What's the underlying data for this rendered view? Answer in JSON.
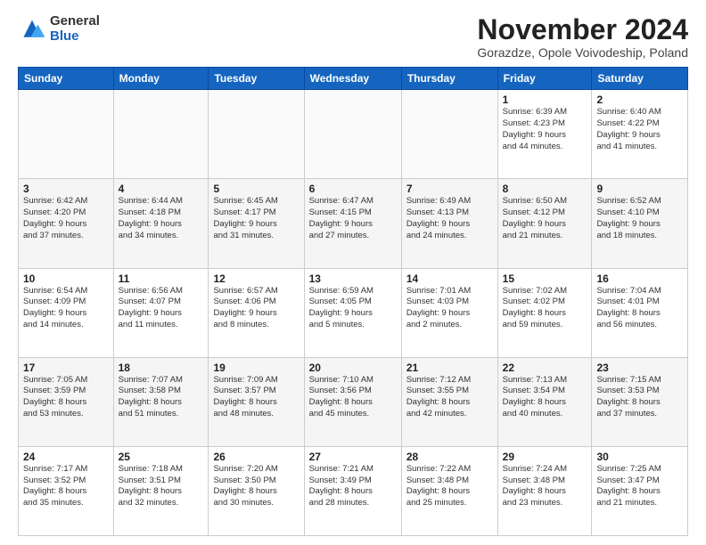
{
  "logo": {
    "general": "General",
    "blue": "Blue"
  },
  "header": {
    "month": "November 2024",
    "location": "Gorazdze, Opole Voivodeship, Poland"
  },
  "days_of_week": [
    "Sunday",
    "Monday",
    "Tuesday",
    "Wednesday",
    "Thursday",
    "Friday",
    "Saturday"
  ],
  "weeks": [
    [
      {
        "day": "",
        "info": ""
      },
      {
        "day": "",
        "info": ""
      },
      {
        "day": "",
        "info": ""
      },
      {
        "day": "",
        "info": ""
      },
      {
        "day": "",
        "info": ""
      },
      {
        "day": "1",
        "info": "Sunrise: 6:39 AM\nSunset: 4:23 PM\nDaylight: 9 hours\nand 44 minutes."
      },
      {
        "day": "2",
        "info": "Sunrise: 6:40 AM\nSunset: 4:22 PM\nDaylight: 9 hours\nand 41 minutes."
      }
    ],
    [
      {
        "day": "3",
        "info": "Sunrise: 6:42 AM\nSunset: 4:20 PM\nDaylight: 9 hours\nand 37 minutes."
      },
      {
        "day": "4",
        "info": "Sunrise: 6:44 AM\nSunset: 4:18 PM\nDaylight: 9 hours\nand 34 minutes."
      },
      {
        "day": "5",
        "info": "Sunrise: 6:45 AM\nSunset: 4:17 PM\nDaylight: 9 hours\nand 31 minutes."
      },
      {
        "day": "6",
        "info": "Sunrise: 6:47 AM\nSunset: 4:15 PM\nDaylight: 9 hours\nand 27 minutes."
      },
      {
        "day": "7",
        "info": "Sunrise: 6:49 AM\nSunset: 4:13 PM\nDaylight: 9 hours\nand 24 minutes."
      },
      {
        "day": "8",
        "info": "Sunrise: 6:50 AM\nSunset: 4:12 PM\nDaylight: 9 hours\nand 21 minutes."
      },
      {
        "day": "9",
        "info": "Sunrise: 6:52 AM\nSunset: 4:10 PM\nDaylight: 9 hours\nand 18 minutes."
      }
    ],
    [
      {
        "day": "10",
        "info": "Sunrise: 6:54 AM\nSunset: 4:09 PM\nDaylight: 9 hours\nand 14 minutes."
      },
      {
        "day": "11",
        "info": "Sunrise: 6:56 AM\nSunset: 4:07 PM\nDaylight: 9 hours\nand 11 minutes."
      },
      {
        "day": "12",
        "info": "Sunrise: 6:57 AM\nSunset: 4:06 PM\nDaylight: 9 hours\nand 8 minutes."
      },
      {
        "day": "13",
        "info": "Sunrise: 6:59 AM\nSunset: 4:05 PM\nDaylight: 9 hours\nand 5 minutes."
      },
      {
        "day": "14",
        "info": "Sunrise: 7:01 AM\nSunset: 4:03 PM\nDaylight: 9 hours\nand 2 minutes."
      },
      {
        "day": "15",
        "info": "Sunrise: 7:02 AM\nSunset: 4:02 PM\nDaylight: 8 hours\nand 59 minutes."
      },
      {
        "day": "16",
        "info": "Sunrise: 7:04 AM\nSunset: 4:01 PM\nDaylight: 8 hours\nand 56 minutes."
      }
    ],
    [
      {
        "day": "17",
        "info": "Sunrise: 7:05 AM\nSunset: 3:59 PM\nDaylight: 8 hours\nand 53 minutes."
      },
      {
        "day": "18",
        "info": "Sunrise: 7:07 AM\nSunset: 3:58 PM\nDaylight: 8 hours\nand 51 minutes."
      },
      {
        "day": "19",
        "info": "Sunrise: 7:09 AM\nSunset: 3:57 PM\nDaylight: 8 hours\nand 48 minutes."
      },
      {
        "day": "20",
        "info": "Sunrise: 7:10 AM\nSunset: 3:56 PM\nDaylight: 8 hours\nand 45 minutes."
      },
      {
        "day": "21",
        "info": "Sunrise: 7:12 AM\nSunset: 3:55 PM\nDaylight: 8 hours\nand 42 minutes."
      },
      {
        "day": "22",
        "info": "Sunrise: 7:13 AM\nSunset: 3:54 PM\nDaylight: 8 hours\nand 40 minutes."
      },
      {
        "day": "23",
        "info": "Sunrise: 7:15 AM\nSunset: 3:53 PM\nDaylight: 8 hours\nand 37 minutes."
      }
    ],
    [
      {
        "day": "24",
        "info": "Sunrise: 7:17 AM\nSunset: 3:52 PM\nDaylight: 8 hours\nand 35 minutes."
      },
      {
        "day": "25",
        "info": "Sunrise: 7:18 AM\nSunset: 3:51 PM\nDaylight: 8 hours\nand 32 minutes."
      },
      {
        "day": "26",
        "info": "Sunrise: 7:20 AM\nSunset: 3:50 PM\nDaylight: 8 hours\nand 30 minutes."
      },
      {
        "day": "27",
        "info": "Sunrise: 7:21 AM\nSunset: 3:49 PM\nDaylight: 8 hours\nand 28 minutes."
      },
      {
        "day": "28",
        "info": "Sunrise: 7:22 AM\nSunset: 3:48 PM\nDaylight: 8 hours\nand 25 minutes."
      },
      {
        "day": "29",
        "info": "Sunrise: 7:24 AM\nSunset: 3:48 PM\nDaylight: 8 hours\nand 23 minutes."
      },
      {
        "day": "30",
        "info": "Sunrise: 7:25 AM\nSunset: 3:47 PM\nDaylight: 8 hours\nand 21 minutes."
      }
    ]
  ]
}
